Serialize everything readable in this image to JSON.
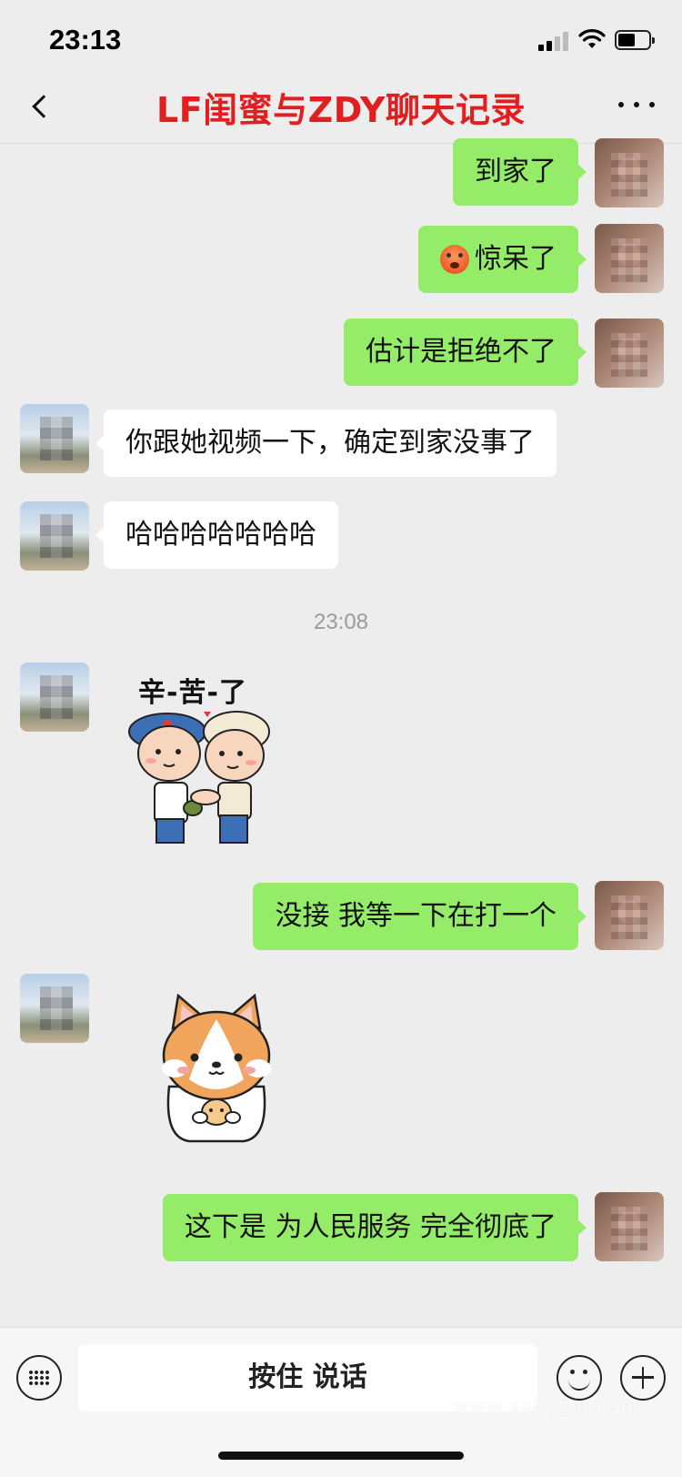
{
  "status_bar": {
    "time": "23:13"
  },
  "nav": {
    "title": "LF闺蜜与ZDY聊天记录"
  },
  "messages": [
    {
      "side": "me",
      "text": "到家了"
    },
    {
      "side": "me",
      "text": "惊呆了",
      "emoji": "shocked-face-icon"
    },
    {
      "side": "me",
      "text": "估计是拒绝不了"
    },
    {
      "side": "other",
      "text": "你跟她视频一下，确定到家没事了"
    },
    {
      "side": "other",
      "text": "哈哈哈哈哈哈哈"
    },
    {
      "side": "me",
      "text": "没接 我等一下在打一个"
    },
    {
      "side": "me",
      "text": "这下是 为人民服务 完全彻底了"
    }
  ],
  "timestamp": "23:08",
  "sticker_1": {
    "caption": "辛-苦-了"
  },
  "input_bar": {
    "talk_label": "按住 说话"
  },
  "watermark": "www.xxbozm.com",
  "colors": {
    "my_bubble": "#95ec69",
    "other_bubble": "#ffffff",
    "title": "#e02020",
    "background": "#ededed"
  }
}
